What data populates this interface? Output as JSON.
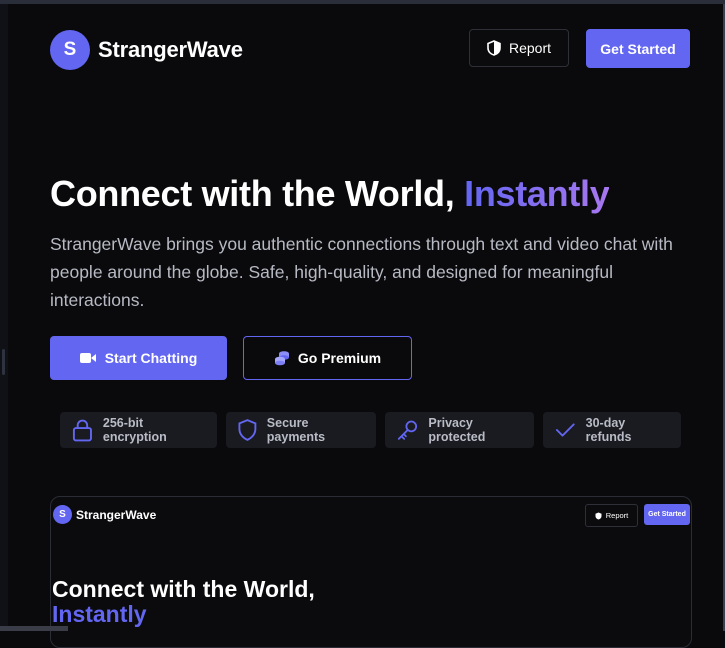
{
  "brand": {
    "initial": "S",
    "name": "StrangerWave"
  },
  "header": {
    "report_label": "Report",
    "get_started_label": "Get Started"
  },
  "hero": {
    "title_main": "Connect with the World, ",
    "title_accent": "Instantly",
    "description": "StrangerWave brings you authentic connections through text and video chat with people around the globe. Safe, high-quality, and designed for meaningful interactions."
  },
  "cta": {
    "primary_label": "Start Chatting",
    "secondary_label": "Go Premium"
  },
  "features": [
    {
      "label": "256-bit encryption",
      "icon": "lock-icon"
    },
    {
      "label": "Secure payments",
      "icon": "shield-icon"
    },
    {
      "label": "Privacy protected",
      "icon": "key-icon"
    },
    {
      "label": "30-day refunds",
      "icon": "check-icon"
    }
  ],
  "preview": {
    "brand_initial": "S",
    "brand_name": "StrangerWave",
    "report_label": "Report",
    "get_started_label": "Get Started",
    "title_main": "Connect with the World,",
    "title_accent": "Instantly"
  },
  "colors": {
    "accent": "#6366f1",
    "accent_end": "#a777f0",
    "background": "#0a0a0c",
    "chip": "#1a1b20"
  }
}
